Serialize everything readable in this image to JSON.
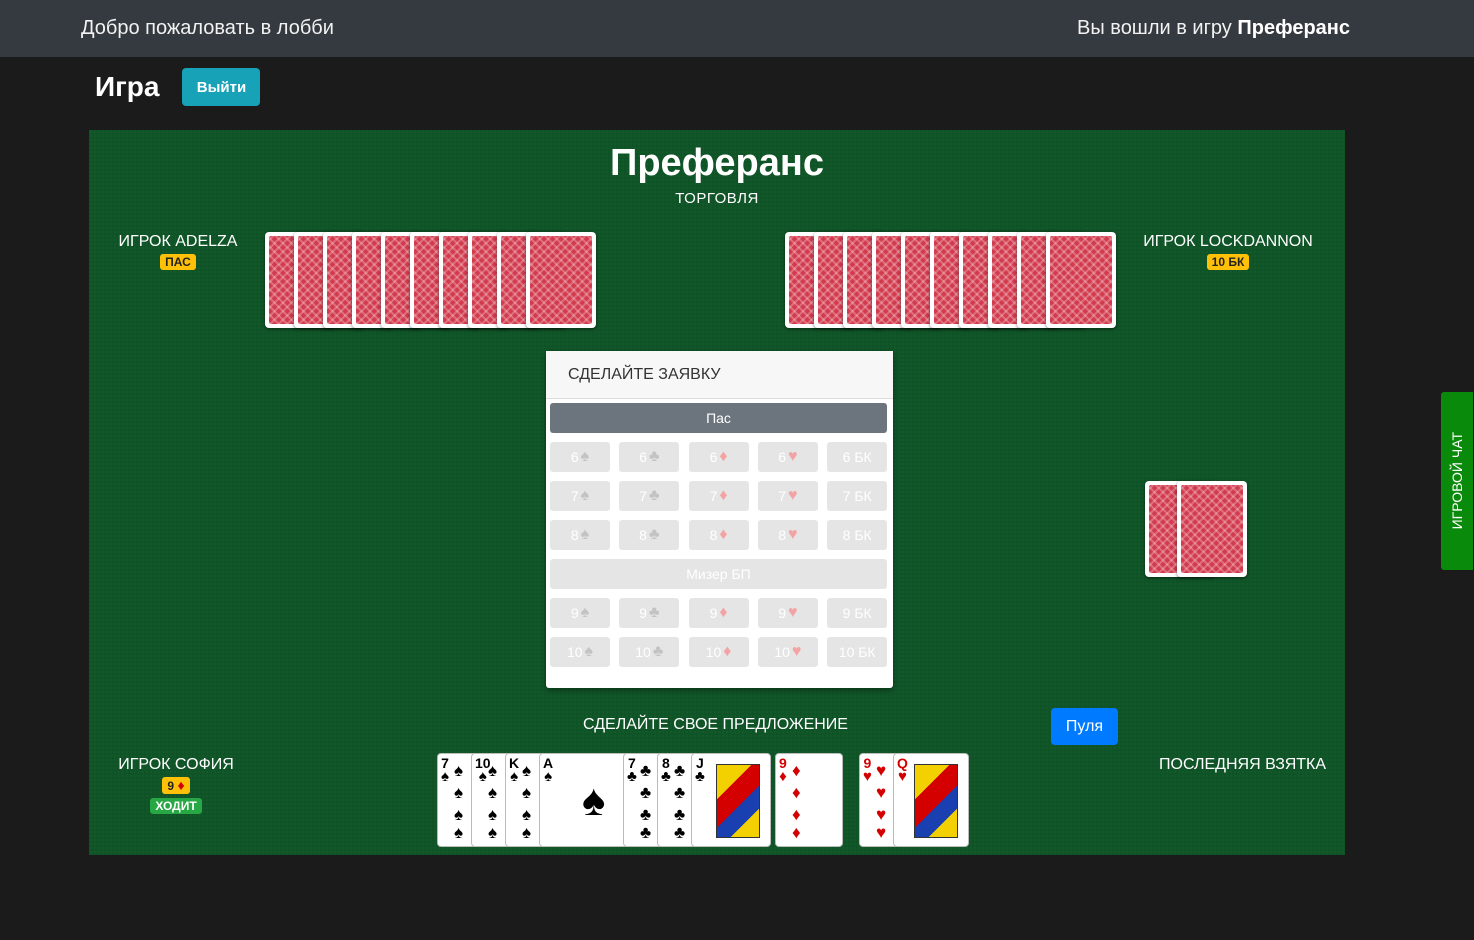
{
  "topbar": {
    "welcome": "Добро пожаловать в лобби",
    "joined_prefix": "Вы вошли в игру",
    "joined_game": "Преферанс"
  },
  "page": {
    "title": "Игра",
    "exit_label": "Выйти"
  },
  "table": {
    "title": "Преферанс",
    "phase": "ТОРГОВЛЯ",
    "players": {
      "left": {
        "name": "ИГРОК ADELZA",
        "badge": "ПАС"
      },
      "right": {
        "name": "ИГРОК LOCKDANNON",
        "badge": "10 БК"
      },
      "me": {
        "name": "ИГРОК СОФИЯ",
        "bid_value": "9",
        "bid_suit": "♦",
        "status": "ХОДИТ"
      }
    },
    "offer_text": "СДЕЛАЙТЕ СВОЕ ПРЕДЛОЖЕНИЕ",
    "pulya_label": "Пуля",
    "last_trick_label": "ПОСЛЕДНЯЯ ВЗЯТКА"
  },
  "bid_panel": {
    "title": "СДЕЛАЙТЕ ЗАЯВКУ",
    "pass_label": "Пас",
    "rows_a": [
      [
        "6",
        "6",
        "6",
        "6",
        "6 БК"
      ],
      [
        "7",
        "7",
        "7",
        "7",
        "7 БК"
      ],
      [
        "8",
        "8",
        "8",
        "8",
        "8 БК"
      ]
    ],
    "misere_label": "Мизер БП",
    "rows_b": [
      [
        "9",
        "9",
        "9",
        "9",
        "9 БК"
      ],
      [
        "10",
        "10",
        "10",
        "10",
        "10 БК"
      ]
    ],
    "suits": [
      "♠",
      "♣",
      "♦",
      "♥"
    ]
  },
  "hand": {
    "cards": [
      {
        "rank": "7",
        "suit": "♠"
      },
      {
        "rank": "10",
        "suit": "♠"
      },
      {
        "rank": "K",
        "suit": "♠"
      },
      {
        "rank": "A",
        "suit": "♠"
      },
      {
        "rank": "7",
        "suit": "♣"
      },
      {
        "rank": "8",
        "suit": "♣"
      },
      {
        "rank": "J",
        "suit": "♣"
      },
      {
        "rank": "9",
        "suit": "♦"
      },
      {
        "rank": "9",
        "suit": "♥"
      },
      {
        "rank": "Q",
        "suit": "♥"
      }
    ]
  },
  "chat": {
    "label": "ИГРОВОЙ ЧАТ"
  },
  "colors": {
    "table": "#0f5427",
    "topbar": "#343a40",
    "exit": "#17a2b8",
    "pulya": "#007bff",
    "badge": "#ffc107",
    "chat": "#0a8a0a"
  }
}
